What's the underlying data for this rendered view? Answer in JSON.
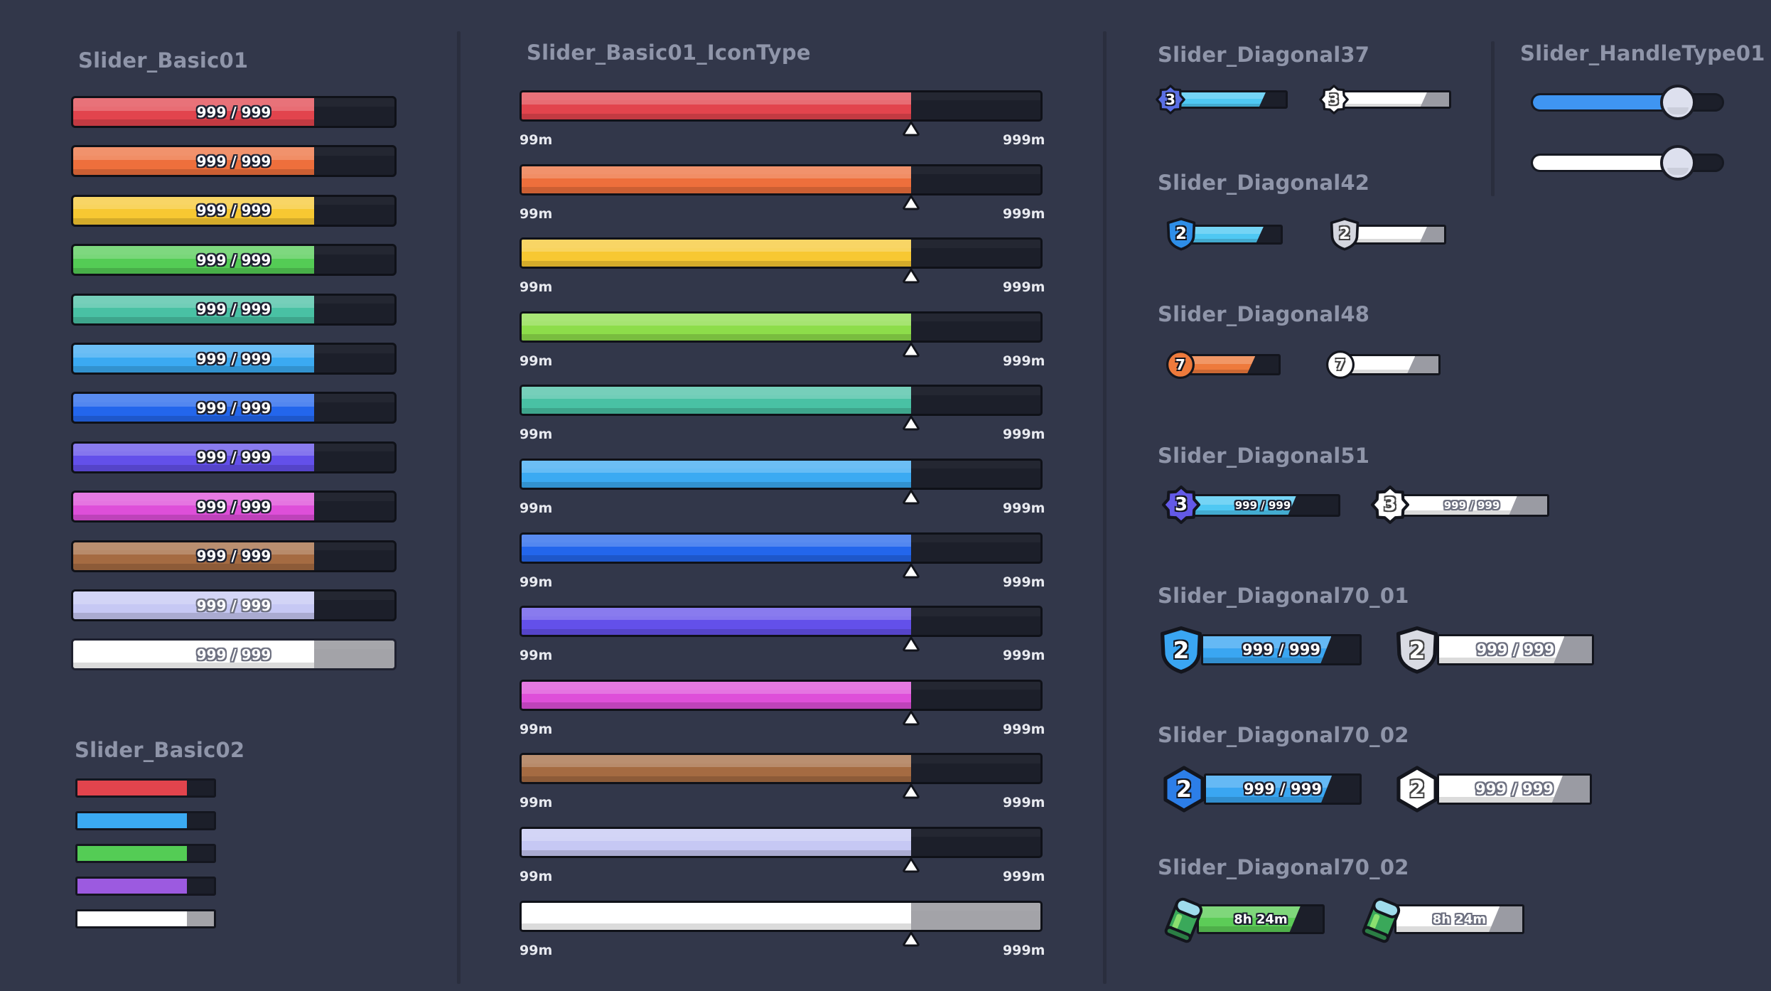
{
  "sections": {
    "basic01": "Slider_Basic01",
    "basic02": "Slider_Basic02",
    "icontype": "Slider_Basic01_IconType",
    "diag37": "Slider_Diagonal37",
    "handle": "Slider_HandleType01",
    "diag42": "Slider_Diagonal42",
    "diag48": "Slider_Diagonal48",
    "diag51": "Slider_Diagonal51",
    "diag70_01": "Slider_Diagonal70_01",
    "diag70_02": "Slider_Diagonal70_02",
    "diag70_02b": "Slider_Diagonal70_02"
  },
  "basic01_bars": [
    {
      "color": "#e2444d",
      "label": "999 / 999",
      "progress": 0.75
    },
    {
      "color": "#ee6f3c",
      "label": "999 / 999",
      "progress": 0.75
    },
    {
      "color": "#f7c832",
      "label": "999 / 999",
      "progress": 0.75
    },
    {
      "color": "#54cc55",
      "label": "999 / 999",
      "progress": 0.75
    },
    {
      "color": "#49c1a4",
      "label": "999 / 999",
      "progress": 0.75
    },
    {
      "color": "#3baaf2",
      "label": "999 / 999",
      "progress": 0.75
    },
    {
      "color": "#2366ec",
      "label": "999 / 999",
      "progress": 0.75
    },
    {
      "color": "#6350ea",
      "label": "999 / 999",
      "progress": 0.75
    },
    {
      "color": "#de4fd9",
      "label": "999 / 999",
      "progress": 0.75
    },
    {
      "color": "#a56b42",
      "label": "999 / 999",
      "progress": 0.75
    },
    {
      "color": "#c6c8f4",
      "label": "999 / 999",
      "progress": 0.75
    },
    {
      "color": "#ffffff",
      "label": "999 / 999",
      "progress": 0.75
    }
  ],
  "basic02_bars": [
    {
      "color": "#e2444d",
      "progress": 0.8
    },
    {
      "color": "#3baaf2",
      "progress": 0.8
    },
    {
      "color": "#54cc55",
      "progress": 0.8
    },
    {
      "color": "#9c5ae0",
      "progress": 0.8
    },
    {
      "color": "#ffffff",
      "progress": 0.8
    }
  ],
  "icontype_bars": [
    {
      "color": "#e2444d",
      "min": "99m",
      "max": "999m",
      "progress": 0.75
    },
    {
      "color": "#ee6f3c",
      "min": "99m",
      "max": "999m",
      "progress": 0.75
    },
    {
      "color": "#f7c832",
      "min": "99m",
      "max": "999m",
      "progress": 0.75
    },
    {
      "color": "#8ddd4a",
      "min": "99m",
      "max": "999m",
      "progress": 0.75
    },
    {
      "color": "#49c1a4",
      "min": "99m",
      "max": "999m",
      "progress": 0.75
    },
    {
      "color": "#3baaf2",
      "min": "99m",
      "max": "999m",
      "progress": 0.75
    },
    {
      "color": "#2366ec",
      "min": "99m",
      "max": "999m",
      "progress": 0.75
    },
    {
      "color": "#6350ea",
      "min": "99m",
      "max": "999m",
      "progress": 0.75
    },
    {
      "color": "#de4fd9",
      "min": "99m",
      "max": "999m",
      "progress": 0.75
    },
    {
      "color": "#a56b42",
      "min": "99m",
      "max": "999m",
      "progress": 0.75
    },
    {
      "color": "#c6c8f4",
      "min": "99m",
      "max": "999m",
      "progress": 0.75
    },
    {
      "color": "#ffffff",
      "min": "99m",
      "max": "999m",
      "progress": 0.75
    }
  ],
  "diag37": [
    {
      "badge": "3",
      "fill": "#4fc8f3",
      "badge_color": "#5a6fe4",
      "progress": 0.82
    },
    {
      "badge": "3",
      "fill": "#ffffff",
      "badge_color": "#ffffff",
      "progress": 0.8
    }
  ],
  "diag42": [
    {
      "badge": "2",
      "fill": "#4fc8f3",
      "badge_color": "#2e8ee8",
      "progress": 0.82
    },
    {
      "badge": "2",
      "fill": "#ffffff",
      "badge_color": "#d4d6de",
      "progress": 0.82
    }
  ],
  "diag48": [
    {
      "badge": "7",
      "fill": "#ee7a3c",
      "badge_color": "#ee7a3c",
      "progress": 0.75
    },
    {
      "badge": "7",
      "fill": "#ffffff",
      "badge_color": "#ffffff",
      "progress": 0.75
    }
  ],
  "diag51": [
    {
      "badge": "3",
      "fill": "#4fc8f3",
      "badge_color": "#6359e8",
      "label": "999 / 999",
      "progress": 0.72
    },
    {
      "badge": "3",
      "fill": "#ffffff",
      "badge_color": "#ffffff",
      "label": "999 / 999",
      "progress": 0.8
    }
  ],
  "diag70_01": [
    {
      "badge": "2",
      "fill": "#3aa6f2",
      "badge_color": "#3aa6f2",
      "label": "999 / 999",
      "progress": 0.82
    },
    {
      "badge": "2",
      "fill": "#ffffff",
      "badge_color": "#d9dbe3",
      "label": "999 / 999",
      "progress": 0.82
    }
  ],
  "diag70_02": [
    {
      "badge": "2",
      "fill": "#3aa6f2",
      "badge_color": "#2c7ee8",
      "label": "999 / 999",
      "progress": 0.82
    },
    {
      "badge": "2",
      "fill": "#ffffff",
      "badge_color": "#ffffff",
      "label": "999 / 999",
      "progress": 0.82
    }
  ],
  "diag70_02b": [
    {
      "fill": "#5ccc57",
      "label": "8h 24m",
      "icon": "energy-can-icon",
      "progress": 0.82
    },
    {
      "fill": "#ffffff",
      "label": "8h 24m",
      "icon": "energy-can-icon",
      "progress": 0.82
    }
  ],
  "handle": [
    {
      "fill": "#3f95f2",
      "progress": 0.72
    },
    {
      "fill": "#ffffff",
      "progress": 0.72
    }
  ]
}
